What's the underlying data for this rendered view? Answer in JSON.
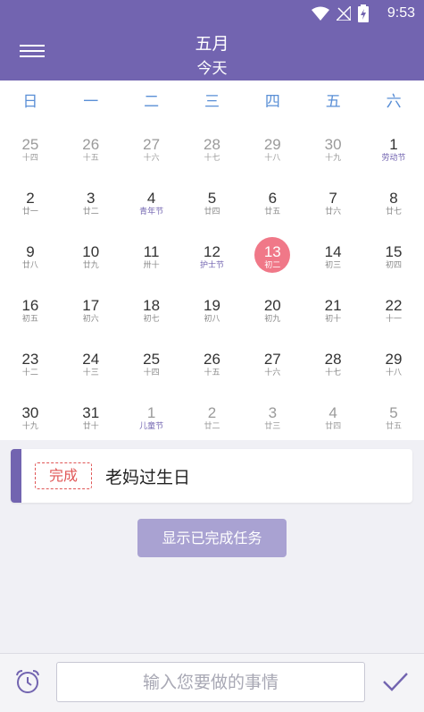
{
  "status": {
    "time": "9:53"
  },
  "header": {
    "title": "五月",
    "subtitle": "今天"
  },
  "weekdays": [
    "日",
    "一",
    "二",
    "三",
    "四",
    "五",
    "六"
  ],
  "days": [
    {
      "day": "25",
      "lunar": "十四",
      "other": true
    },
    {
      "day": "26",
      "lunar": "十五",
      "other": true
    },
    {
      "day": "27",
      "lunar": "十六",
      "other": true
    },
    {
      "day": "28",
      "lunar": "十七",
      "other": true
    },
    {
      "day": "29",
      "lunar": "十八",
      "other": true
    },
    {
      "day": "30",
      "lunar": "十九",
      "other": true
    },
    {
      "day": "1",
      "lunar": "劳动节",
      "fest": true
    },
    {
      "day": "2",
      "lunar": "廿一"
    },
    {
      "day": "3",
      "lunar": "廿二"
    },
    {
      "day": "4",
      "lunar": "青年节",
      "fest": true
    },
    {
      "day": "5",
      "lunar": "廿四"
    },
    {
      "day": "6",
      "lunar": "廿五"
    },
    {
      "day": "7",
      "lunar": "廿六"
    },
    {
      "day": "8",
      "lunar": "廿七"
    },
    {
      "day": "9",
      "lunar": "廿八"
    },
    {
      "day": "10",
      "lunar": "廿九"
    },
    {
      "day": "11",
      "lunar": "卅十"
    },
    {
      "day": "12",
      "lunar": "护士节",
      "fest": true
    },
    {
      "day": "13",
      "lunar": "初二",
      "today": true
    },
    {
      "day": "14",
      "lunar": "初三"
    },
    {
      "day": "15",
      "lunar": "初四"
    },
    {
      "day": "16",
      "lunar": "初五"
    },
    {
      "day": "17",
      "lunar": "初六"
    },
    {
      "day": "18",
      "lunar": "初七"
    },
    {
      "day": "19",
      "lunar": "初八"
    },
    {
      "day": "20",
      "lunar": "初九"
    },
    {
      "day": "21",
      "lunar": "初十"
    },
    {
      "day": "22",
      "lunar": "十一"
    },
    {
      "day": "23",
      "lunar": "十二"
    },
    {
      "day": "24",
      "lunar": "十三"
    },
    {
      "day": "25",
      "lunar": "十四"
    },
    {
      "day": "26",
      "lunar": "十五"
    },
    {
      "day": "27",
      "lunar": "十六"
    },
    {
      "day": "28",
      "lunar": "十七"
    },
    {
      "day": "29",
      "lunar": "十八"
    },
    {
      "day": "30",
      "lunar": "十九"
    },
    {
      "day": "31",
      "lunar": "廿十"
    },
    {
      "day": "1",
      "lunar": "儿童节",
      "fest": true,
      "other": true
    },
    {
      "day": "2",
      "lunar": "廿二",
      "other": true
    },
    {
      "day": "3",
      "lunar": "廿三",
      "other": true
    },
    {
      "day": "4",
      "lunar": "廿四",
      "other": true
    },
    {
      "day": "5",
      "lunar": "廿五",
      "other": true
    }
  ],
  "task": {
    "badge": "完成",
    "title": "老妈过生日"
  },
  "show_completed_label": "显示已完成任务",
  "input": {
    "placeholder": "输入您要做的事情",
    "value": ""
  },
  "icons": {
    "menu": "menu-icon",
    "alarm": "alarm-clock-icon",
    "confirm": "checkmark-icon",
    "wifi": "wifi-icon",
    "signal": "no-signal-icon",
    "battery": "battery-charging-icon"
  },
  "colors": {
    "primary": "#7264b0",
    "today": "#f07888",
    "weekday": "#5a8fd6",
    "badge": "#e05656",
    "button": "#a9a2d2"
  }
}
